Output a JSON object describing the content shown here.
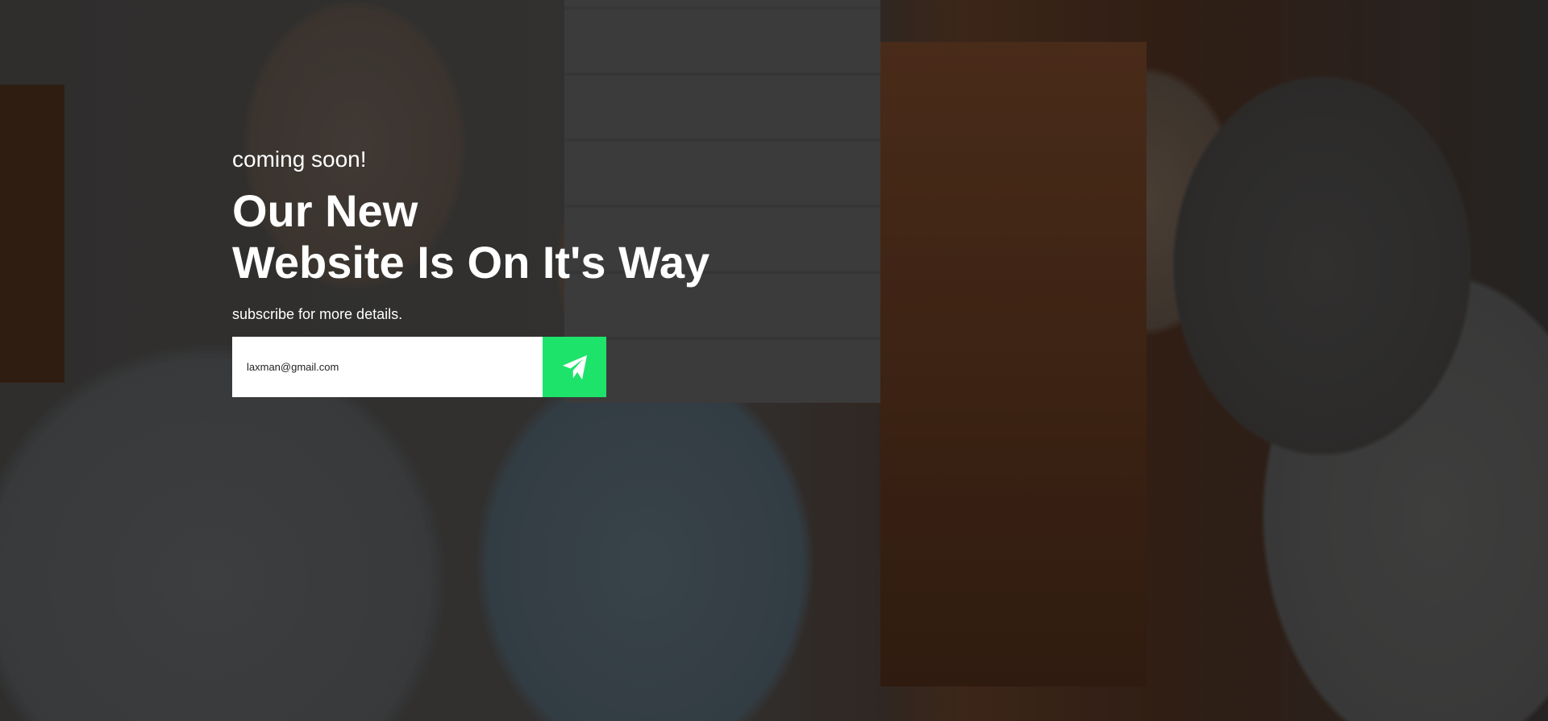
{
  "hero": {
    "kicker": "coming soon!",
    "headline_line1": "Our New",
    "headline_line2": "Website Is On It's Way",
    "subtext": "subscribe for more details."
  },
  "subscribe": {
    "email_value": "laxman@gmail.com",
    "submit_icon": "paper-plane-icon",
    "button_color": "#1ee36b"
  }
}
